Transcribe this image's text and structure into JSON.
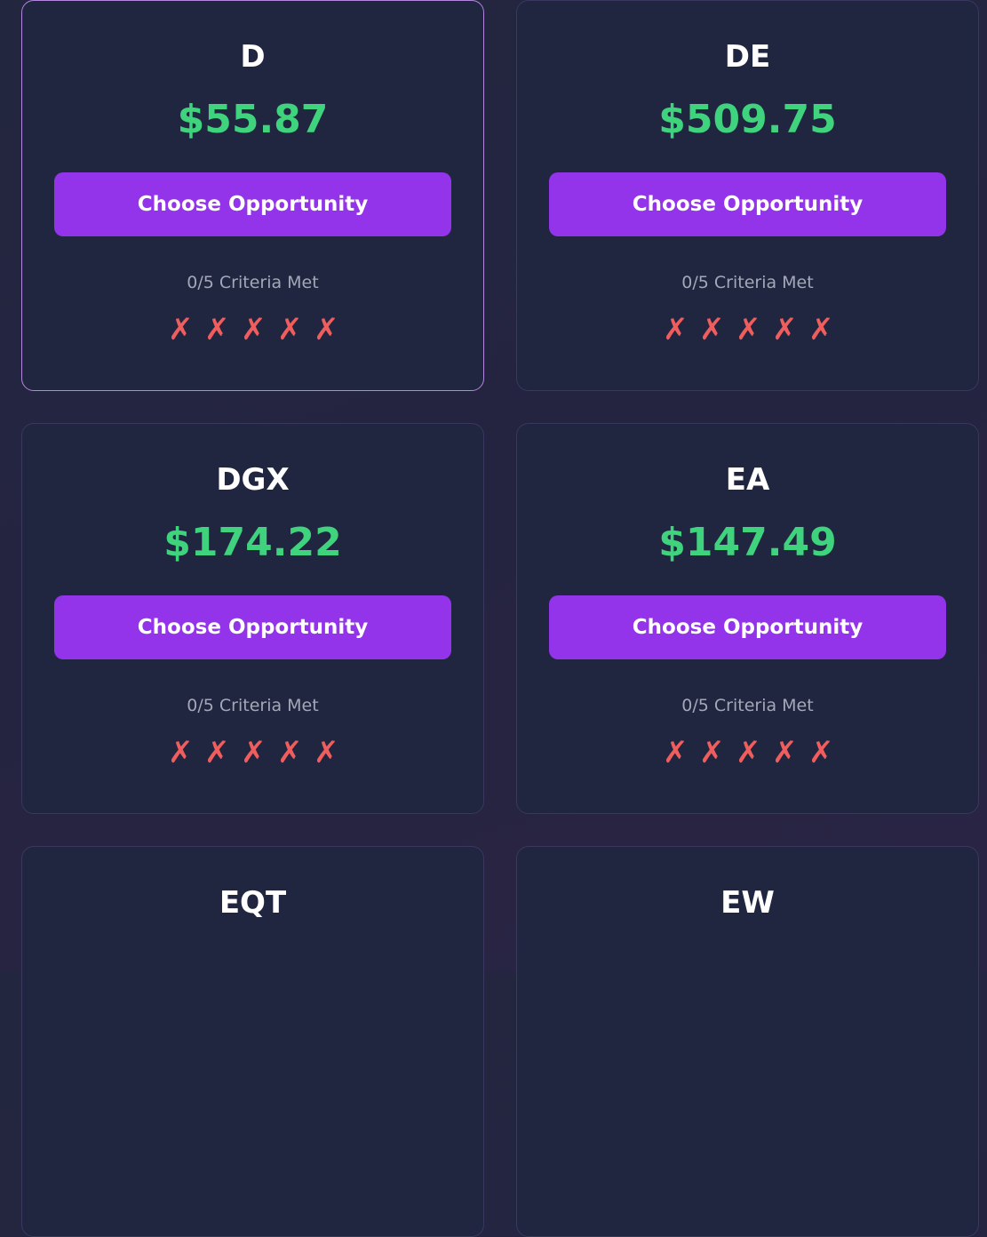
{
  "cards": [
    {
      "ticker": "",
      "price": "",
      "button_label": "",
      "criteria_text": "",
      "marks": []
    },
    {
      "ticker": "",
      "price": "",
      "button_label": "",
      "criteria_text": "",
      "marks": []
    },
    {
      "ticker": "D",
      "price": "$55.87",
      "button_label": "Choose Opportunity",
      "criteria_text": "0/5 Criteria Met",
      "marks": [
        "✗",
        "✗",
        "✗",
        "✗",
        "✗"
      ],
      "selected": true
    },
    {
      "ticker": "DE",
      "price": "$509.75",
      "button_label": "Choose Opportunity",
      "criteria_text": "0/5 Criteria Met",
      "marks": [
        "✗",
        "✗",
        "✗",
        "✗",
        "✗"
      ]
    },
    {
      "ticker": "DGX",
      "price": "$174.22",
      "button_label": "Choose Opportunity",
      "criteria_text": "0/5 Criteria Met",
      "marks": [
        "✗",
        "✗",
        "✗",
        "✗",
        "✗"
      ]
    },
    {
      "ticker": "EA",
      "price": "$147.49",
      "button_label": "Choose Opportunity",
      "criteria_text": "0/5 Criteria Met",
      "marks": [
        "✗",
        "✗",
        "✗",
        "✗",
        "✗"
      ]
    },
    {
      "ticker": "EQT",
      "price": "",
      "button_label": "",
      "criteria_text": "",
      "marks": []
    },
    {
      "ticker": "EW",
      "price": "",
      "button_label": "",
      "criteria_text": "",
      "marks": []
    }
  ],
  "colors": {
    "price": "#3fd37e",
    "button": "#9333ea",
    "fail_mark": "#ef5d5d",
    "selected_border": "#b386e0"
  },
  "icons": {
    "fail_mark": "x-mark-icon"
  }
}
